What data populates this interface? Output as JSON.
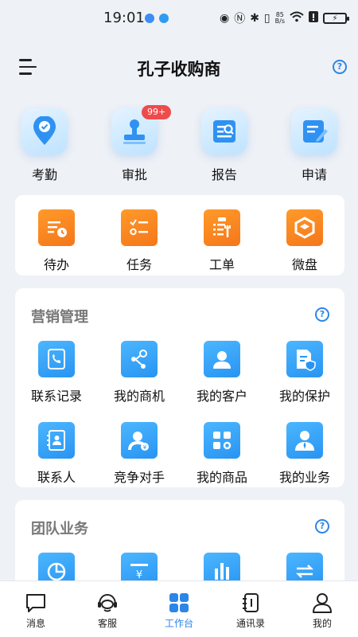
{
  "status_bar": {
    "time": "19:01",
    "net_speed_value": "85",
    "net_speed_unit": "B/s"
  },
  "header": {
    "title": "孔子收购商",
    "help_symbol": "?"
  },
  "quick_actions": [
    {
      "label": "考勤",
      "icon": "location-check-icon"
    },
    {
      "label": "审批",
      "icon": "stamp-icon",
      "badge": "99+"
    },
    {
      "label": "报告",
      "icon": "report-search-icon"
    },
    {
      "label": "申请",
      "icon": "application-edit-icon"
    }
  ],
  "tools": [
    {
      "label": "待办",
      "icon": "todo-clock-icon"
    },
    {
      "label": "任务",
      "icon": "task-checklist-icon"
    },
    {
      "label": "工单",
      "icon": "work-order-icon"
    },
    {
      "label": "微盘",
      "icon": "cloud-disk-icon"
    }
  ],
  "marketing": {
    "title": "营销管理",
    "items": [
      {
        "label": "联系记录",
        "icon": "contact-record-icon"
      },
      {
        "label": "我的商机",
        "icon": "opportunity-icon"
      },
      {
        "label": "我的客户",
        "icon": "customer-icon"
      },
      {
        "label": "我的保护",
        "icon": "protection-icon"
      },
      {
        "label": "联系人",
        "icon": "address-book-icon"
      },
      {
        "label": "竞争对手",
        "icon": "competitor-icon"
      },
      {
        "label": "我的商品",
        "icon": "products-icon"
      },
      {
        "label": "我的业务",
        "icon": "business-icon"
      }
    ]
  },
  "team": {
    "title": "团队业务",
    "items": [
      {
        "icon": "pie-chart-icon"
      },
      {
        "icon": "yen-invoice-icon"
      },
      {
        "icon": "bar-stats-icon"
      },
      {
        "icon": "exchange-icon"
      }
    ]
  },
  "bottom_nav": [
    {
      "label": "消息",
      "icon": "message-icon"
    },
    {
      "label": "客服",
      "icon": "headset-icon"
    },
    {
      "label": "工作台",
      "icon": "workbench-grid-icon",
      "active": true
    },
    {
      "label": "通讯录",
      "icon": "contacts-book-icon"
    },
    {
      "label": "我的",
      "icon": "profile-icon"
    }
  ],
  "colors": {
    "accent": "#2b86e8",
    "orange_icon": "#f5761a",
    "blue_icon": "#2894f2",
    "badge": "#ef4b4b",
    "background": "#eef1f6"
  }
}
